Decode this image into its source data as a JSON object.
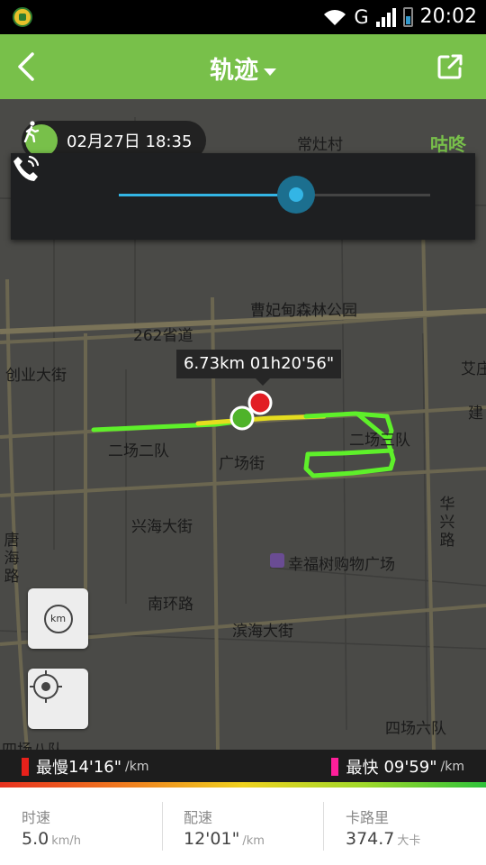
{
  "status_bar": {
    "network": "G",
    "time": "20:02"
  },
  "header": {
    "title": "轨迹"
  },
  "activity": {
    "datetime": "02月27日 18:35",
    "brand": "咕咚"
  },
  "volume": {
    "level": 0.57
  },
  "map": {
    "labels": {
      "changzaocun": "常灶村",
      "forest_park": "曹妃甸森林公园",
      "road_262": "262省道",
      "chuangye": "创业大街",
      "aitai": "艾庄",
      "jian": "建",
      "erchang_erdui": "二场二队",
      "guangchang": "广场街",
      "erchang_sandui": "二场三队",
      "xinghai": "兴海大街",
      "huaxing": "华兴路",
      "tanghai": "唐海路",
      "xingfushu": "幸福树购物广场",
      "nanhuan": "南环路",
      "binhai": "滨海大街",
      "sichang_liudui": "四场六队",
      "sichang_badui": "四场八队"
    },
    "tooltip": "6.73km  01h20'56\"",
    "km_button": "km"
  },
  "pace_legend": {
    "slowest_label": "最慢",
    "slowest_value": "14'16\"",
    "fastest_label": "最快",
    "fastest_value": "09'59\"",
    "unit": "/km",
    "slow_color": "#e8211b",
    "fast_color": "#ff1f9a"
  },
  "stats": [
    {
      "label": "时速",
      "value": "5.0",
      "unit": "km/h"
    },
    {
      "label": "配速",
      "value": "12'01\"",
      "unit": "/km"
    },
    {
      "label": "卡路里",
      "value": "374.7",
      "unit": "大卡"
    }
  ],
  "colors": {
    "brand_green": "#78c04a",
    "route_green": "#5ef02a",
    "route_yellow": "#e5dd1f"
  }
}
